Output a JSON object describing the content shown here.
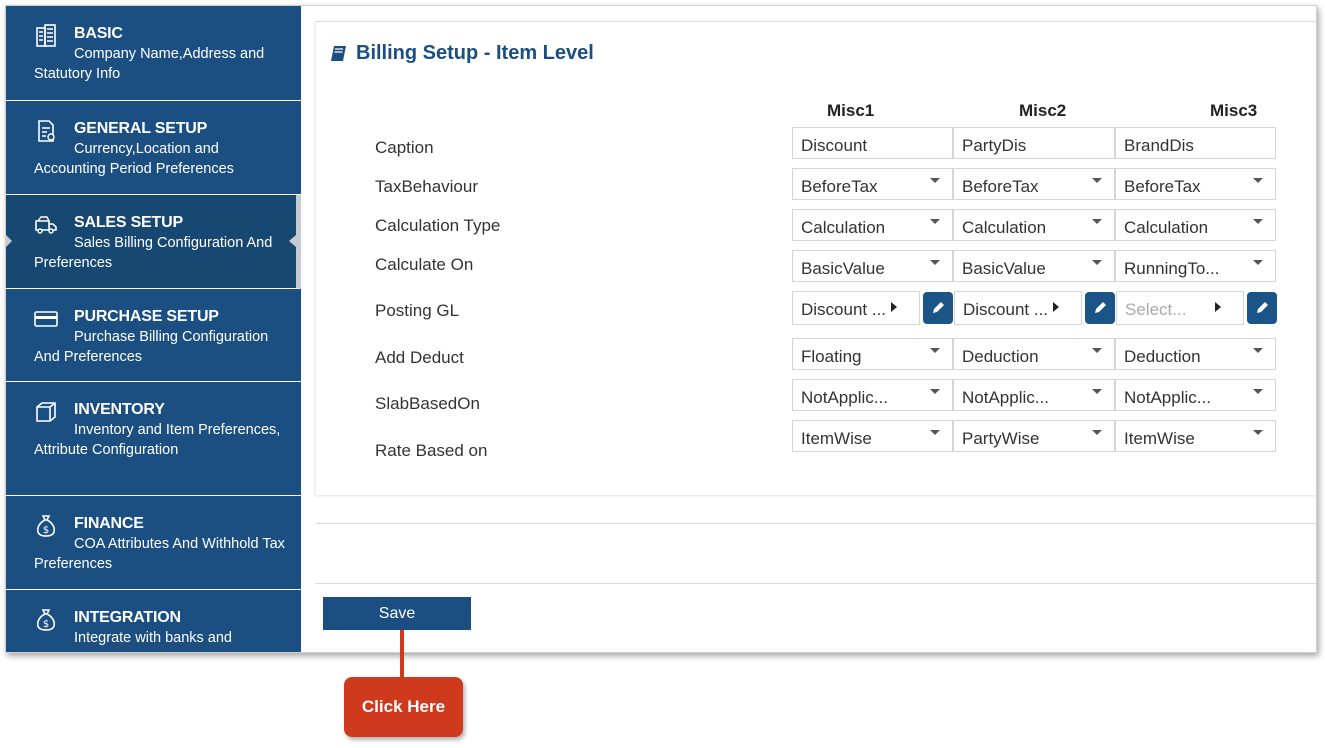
{
  "sidebar": {
    "items": [
      {
        "title": "BASIC",
        "desc": "Company Name,Address and Statutory Info",
        "icon": "building-icon"
      },
      {
        "title": "GENERAL SETUP",
        "desc": "Currency,Location and Accounting Period Preferences",
        "icon": "document-settings-icon"
      },
      {
        "title": "SALES SETUP",
        "desc": "Sales Billing Configuration And Preferences",
        "icon": "van-icon"
      },
      {
        "title": "PURCHASE SETUP",
        "desc": "Purchase Billing Configuration And Preferences",
        "icon": "credit-card-icon"
      },
      {
        "title": "INVENTORY",
        "desc": "Inventory and Item Preferences, Attribute Configuration",
        "icon": "cube-icon"
      },
      {
        "title": "FINANCE",
        "desc": "COA Attributes And Withhold Tax Preferences",
        "icon": "money-bag-icon"
      },
      {
        "title": "INTEGRATION",
        "desc": "Integrate with banks and",
        "icon": "money-bag-icon"
      }
    ],
    "active_index": 2
  },
  "card": {
    "title": "Billing Setup - Item Level",
    "columns": [
      "Misc1",
      "Misc2",
      "Misc3"
    ],
    "rows": [
      {
        "label": "Caption",
        "type": "text",
        "values": [
          "Discount",
          "PartyDis",
          "BrandDis"
        ]
      },
      {
        "label": "TaxBehaviour",
        "type": "select",
        "values": [
          "BeforeTax",
          "BeforeTax",
          "BeforeTax"
        ]
      },
      {
        "label": "Calculation Type",
        "type": "select",
        "values": [
          "Calculation",
          "Calculation",
          "Calculation"
        ]
      },
      {
        "label": "Calculate On",
        "type": "select",
        "values": [
          "BasicValue",
          "BasicValue",
          "RunningTo..."
        ]
      },
      {
        "label": "Posting GL",
        "type": "lookup",
        "values": [
          "Discount ...",
          "Discount ...",
          ""
        ],
        "placeholder": "Select..."
      },
      {
        "label": "Add Deduct",
        "type": "select",
        "values": [
          "Floating",
          "Deduction",
          "Deduction"
        ]
      },
      {
        "label": "SlabBasedOn",
        "type": "select",
        "values": [
          "NotApplic...",
          "NotApplic...",
          "NotApplic..."
        ]
      },
      {
        "label": "Rate Based on",
        "type": "select",
        "values": [
          "ItemWise",
          "PartyWise",
          "ItemWise"
        ]
      }
    ]
  },
  "save_label": "Save",
  "callout_label": "Click Here",
  "colors": {
    "brand": "#1b4f82",
    "callout": "#cf3a1e"
  }
}
